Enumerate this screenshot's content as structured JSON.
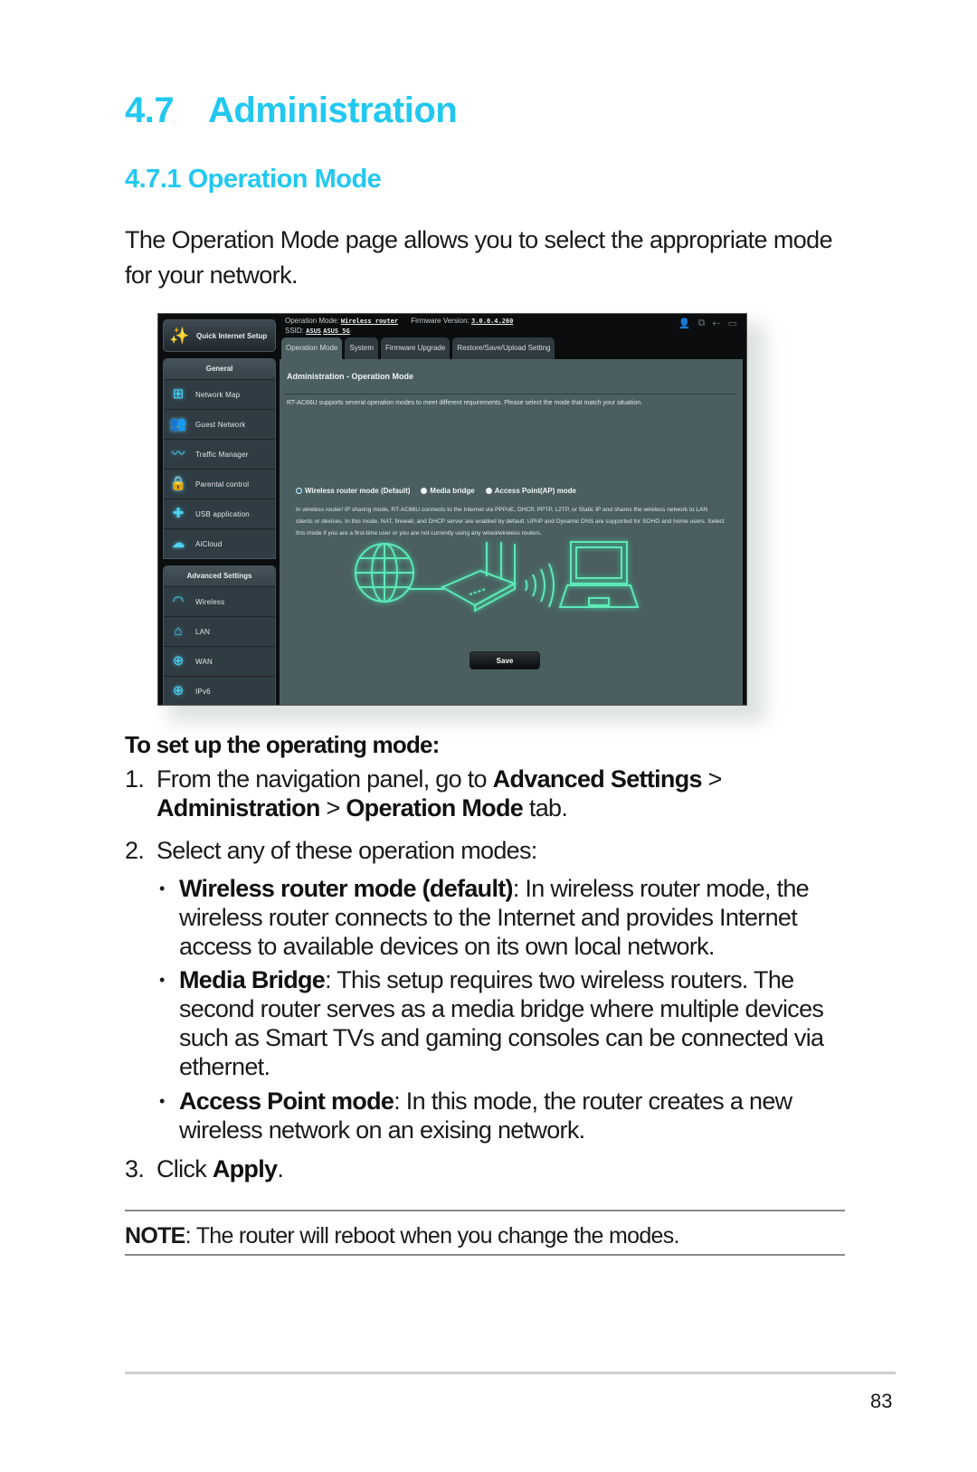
{
  "section": {
    "number": "4.7",
    "title": "Administration"
  },
  "subsection": {
    "number": "4.7.1",
    "title": "Operation Mode"
  },
  "intro": "The Operation Mode page allows you to select the appropriate mode for your network.",
  "router_ui": {
    "quick_setup": "Quick Internet Setup",
    "operation_mode_label": "Operation Mode:",
    "operation_mode_value": "Wireless router",
    "firmware_label": "Firmware Version:",
    "firmware_value": "3.0.0.4.260",
    "ssid_label": "SSID:",
    "ssid_values": [
      "ASUS",
      "ASUS_5G"
    ],
    "status_icons": [
      "user-status-icon",
      "network-status-icon",
      "usb-status-icon",
      "printer-status-icon"
    ],
    "sidebar_general_header": "General",
    "sidebar_general": [
      {
        "label": "Network Map",
        "icon": "network-map-icon"
      },
      {
        "label": "Guest Network",
        "icon": "guest-network-icon"
      },
      {
        "label": "Traffic Manager",
        "icon": "traffic-manager-icon"
      },
      {
        "label": "Parental control",
        "icon": "lock-icon"
      },
      {
        "label": "USB application",
        "icon": "puzzle-icon"
      },
      {
        "label": "AiCloud",
        "icon": "cloud-icon"
      }
    ],
    "sidebar_advanced_header": "Advanced Settings",
    "sidebar_advanced": [
      {
        "label": "Wireless",
        "icon": "wifi-icon"
      },
      {
        "label": "LAN",
        "icon": "home-icon"
      },
      {
        "label": "WAN",
        "icon": "globe-icon"
      },
      {
        "label": "IPv6",
        "icon": "ipv6-icon"
      }
    ],
    "tabs": [
      {
        "label": "Operation Mode",
        "active": true
      },
      {
        "label": "System",
        "active": false
      },
      {
        "label": "Firmware Upgrade",
        "active": false
      },
      {
        "label": "Restore/Save/Upload Setting",
        "active": false
      }
    ],
    "panel_title": "Administration - Operation Mode",
    "panel_desc": "RT-AC66U supports several operation modes to meet different requirements. Please select the mode that match your situation.",
    "modes": [
      {
        "label": "Wireless router mode (Default)",
        "selected": true
      },
      {
        "label": "Media bridge",
        "selected": false
      },
      {
        "label": "Access Point(AP) mode",
        "selected": false
      }
    ],
    "mode_desc": "In wireless router/ IP sharing mode, RT-AC66U connects to the Internet via PPPoE, DHCP, PPTP, L2TP, or Static IP and shares the wireless network to LAN clients or devices. In this mode, NAT, firewall, and DHCP server are enabled by default. UPnP and Dynamic DNS are supported for SOHO and home users. Select this mode if you are a first-time user or you are not currently using any wired/wireless routers.",
    "save_label": "Save",
    "accent": "#4fe0b0"
  },
  "steps_heading": "To set up the operating mode:",
  "steps": [
    {
      "n": "1.",
      "pre": "From the navigation panel, go to ",
      "b1": "Advanced Settings",
      "sep1": " > ",
      "b2": "Administration",
      "sep2": " > ",
      "b3": "Operation Mode",
      "post": " tab."
    },
    {
      "n": "2.",
      "text": "Select any of these operation modes:"
    },
    {
      "n": "3.",
      "pre": "Click ",
      "b1": "Apply",
      "post": "."
    }
  ],
  "bullets": [
    {
      "bold": "Wireless router mode (default)",
      "text": ": In wireless router mode, the wireless router connects to the Internet and provides Internet access to available devices on its own local network."
    },
    {
      "bold": "Media Bridge",
      "text": ": This setup requires two wireless routers. The second router serves as a media bridge where multiple devices such as Smart TVs and gaming consoles can be connected via ethernet."
    },
    {
      "bold": "Access Point mode",
      "text": ": In this mode, the router creates a new wireless network on an exising network."
    }
  ],
  "note": {
    "label": "NOTE",
    "text": ":  The router will reboot when you change the modes."
  },
  "page_number": "83",
  "colors": {
    "heading": "#22c8f0"
  }
}
